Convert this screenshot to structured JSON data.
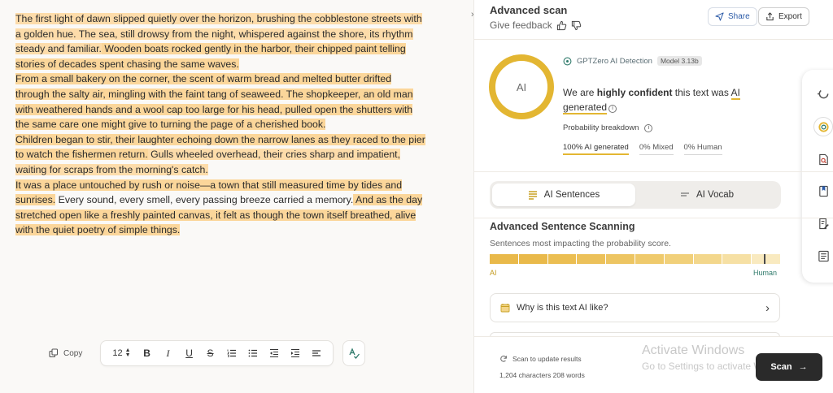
{
  "editor": {
    "sentences": [
      {
        "text": "The first light of dawn slipped quietly over the horizon, brushing the cobblestone streets with a golden hue.",
        "hl": "hl-b"
      },
      {
        "text": " The sea, still drowsy from the night, whispered against the shore, its rhythm steady and familiar.",
        "hl": "hl-b"
      },
      {
        "text": " Wooden boats rocked gently in the harbor, their chipped paint telling stories of decades spent chasing the same waves.",
        "hl": "hl-a"
      },
      {
        "text": "From a small bakery on the corner, the scent of warm bread and melted butter drifted through the salty air, mingling with the faint tang of seaweed.",
        "hl": "hl-a"
      },
      {
        "text": " The shopkeeper, an old man with weathered hands and a wool cap too large for his head, pulled open the shutters with the same care one might give to turning the page of a cherished book.",
        "hl": "hl-a"
      },
      {
        "text": "Children began to stir, their laughter echoing down the narrow lanes as they raced to the pier to watch the fishermen return.",
        "hl": "hl-a"
      },
      {
        "text": " Gulls wheeled overhead, their cries sharp and impatient, waiting for scraps from the morning's catch.",
        "hl": "hl-b"
      },
      {
        "text": "It was a place untouched by rush or noise—a town that still measured time by tides and sunrises.",
        "hl": "hl-a"
      },
      {
        "text": " Every sound, every smell, every passing breeze carried a memory.",
        "hl": "plain"
      },
      {
        "text": " And as the day stretched open like a freshly painted canvas, it felt as though the town itself breathed, alive with the quiet poetry of simple things.",
        "hl": "hl-a"
      }
    ],
    "copy_label": "Copy",
    "font_size": "12",
    "collapse_glyph": "»"
  },
  "header": {
    "title": "Advanced scan",
    "feedback_label": "Give feedback",
    "share_label": "Share",
    "export_label": "Export"
  },
  "result": {
    "ring_label": "AI",
    "detector_name": "GPTZero AI Detection",
    "model_badge": "Model 3.13b",
    "verdict_pre": "We are ",
    "verdict_confidence": "highly confident",
    "verdict_mid": " this text was ",
    "verdict_ai": "AI",
    "verdict_generated": "generated",
    "probability_label": "Probability breakdown",
    "stat_ai": "100% AI generated",
    "stat_mixed": "0% Mixed",
    "stat_human": "0% Human",
    "accent_color": "#e3b632",
    "human_color": "#2f7a6b"
  },
  "tabs": {
    "sentences_label": "AI Sentences",
    "vocab_label": "AI Vocab"
  },
  "scanning": {
    "title": "Advanced Sentence Scanning",
    "subtitle": "Sentences most impacting the probability score.",
    "scale_ai_label": "AI",
    "scale_human_label": "Human",
    "why_label": "Why is this text AI like?"
  },
  "footer": {
    "rescan_label": "Scan to update results",
    "counts": "1,204 characters 208 words",
    "watermark_line1": "Activate Windows",
    "watermark_line2": "Go to Settings to activate Windows.",
    "scan_label": "Scan"
  }
}
